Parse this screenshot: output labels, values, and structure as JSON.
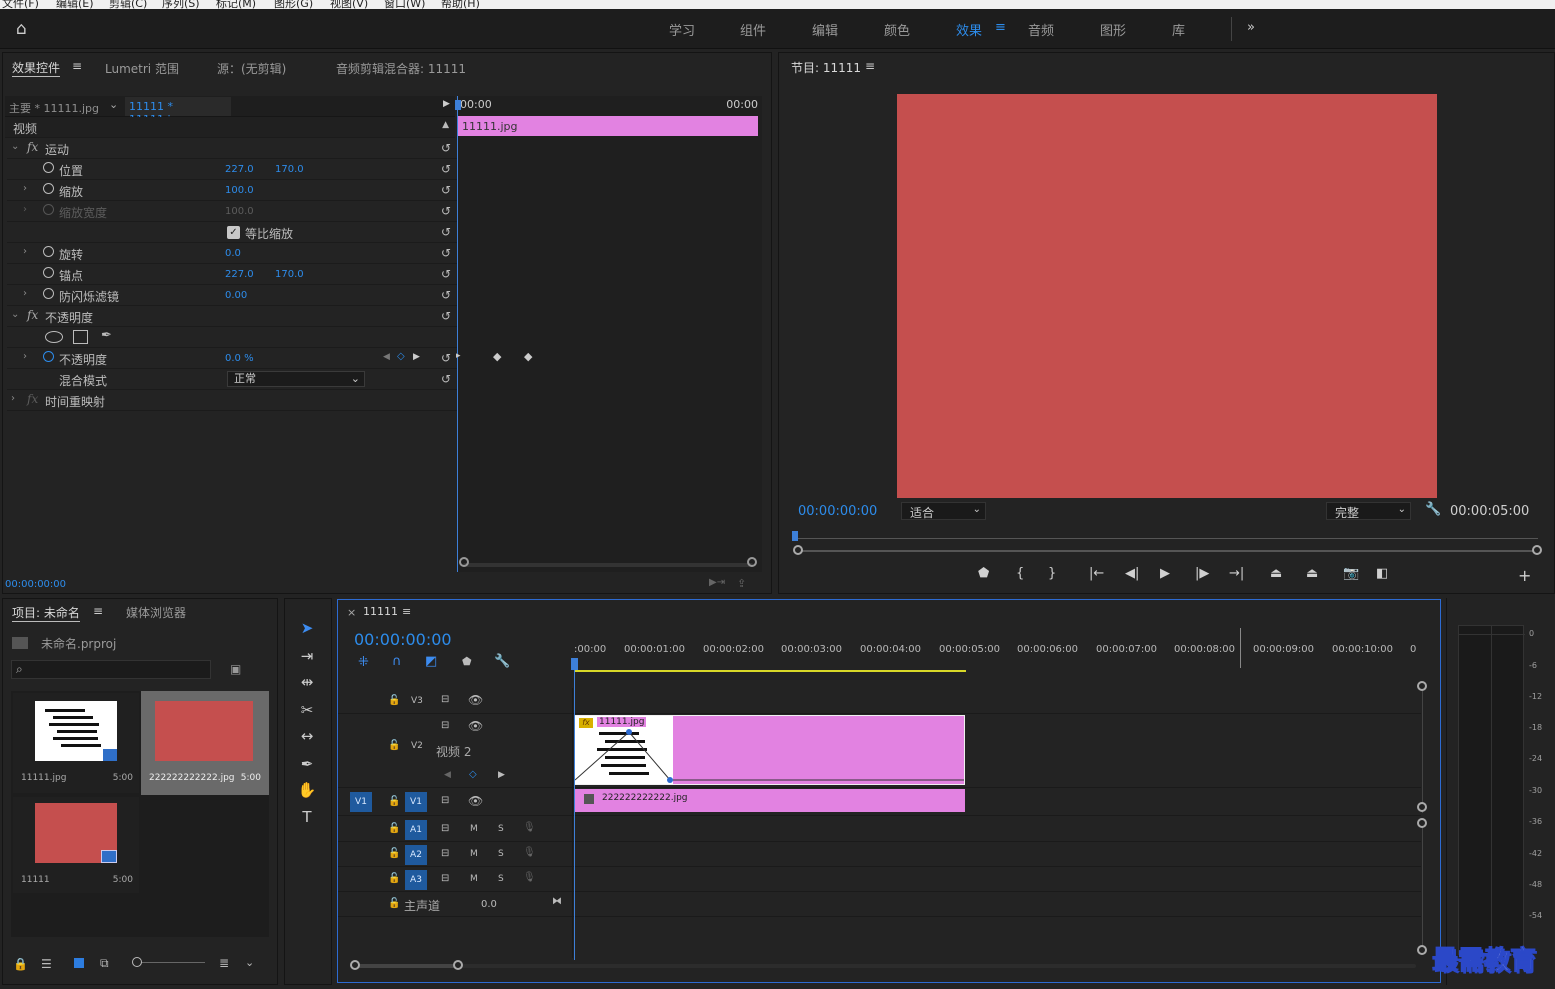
{
  "menubar": [
    "文件(F)",
    "编辑(E)",
    "剪辑(C)",
    "序列(S)",
    "标记(M)",
    "图形(G)",
    "视图(V)",
    "窗口(W)",
    "帮助(H)"
  ],
  "workspaces": [
    "学习",
    "组件",
    "编辑",
    "颜色",
    "效果",
    "音频",
    "图形",
    "库"
  ],
  "active_workspace": "效果",
  "more": "»",
  "effect_panel": {
    "tabs": [
      "效果控件",
      "Lumetri 范围",
      "源：(无剪辑)",
      "音频剪辑混合器: 11111"
    ],
    "menu": "≡",
    "master_clip": "主要 * 11111.jpg",
    "seq_clip": "11111 * 11111.jpg",
    "ruler_start": "00:00",
    "ruler_end": "00:00",
    "clip_bar": "11111.jpg",
    "section_video": "视频",
    "motion": "运动",
    "position": {
      "label": "位置",
      "x": "227.0",
      "y": "170.0"
    },
    "scale": {
      "label": "缩放",
      "value": "100.0"
    },
    "scale_width": {
      "label": "缩放宽度",
      "value": "100.0"
    },
    "uniform_scale": "等比缩放",
    "rotation": {
      "label": "旋转",
      "value": "0.0"
    },
    "anchor": {
      "label": "锚点",
      "x": "227.0",
      "y": "170.0"
    },
    "flicker": {
      "label": "防闪烁滤镜",
      "value": "0.00"
    },
    "opacity_group": "不透明度",
    "opacity": {
      "label": "不透明度",
      "value": "0.0 %"
    },
    "blend": {
      "label": "混合模式",
      "value": "正常"
    },
    "time_remap": "时间重映射",
    "timecode": "00:00:00:00"
  },
  "program": {
    "title": "节目: 11111",
    "timecode": "00:00:00:00",
    "fit": "适合",
    "quality": "完整",
    "duration": "00:00:05:00",
    "frame_color": "#c54f4e"
  },
  "project": {
    "tab": "项目: 未命名",
    "tab2": "媒体浏览器",
    "file": "未命名.prproj",
    "items": [
      {
        "name": "11111.jpg",
        "dur": "5:00"
      },
      {
        "name": "222222222222.jpg",
        "dur": "5:00"
      },
      {
        "name": "11111",
        "dur": "5:00"
      }
    ]
  },
  "timeline": {
    "tab": "11111",
    "timecode": "00:00:00:00",
    "ruler": [
      ":00:00",
      "00:00:01:00",
      "00:00:02:00",
      "00:00:03:00",
      "00:00:04:00",
      "00:00:05:00",
      "00:00:06:00",
      "00:00:07:00",
      "00:00:08:00",
      "00:00:09:00",
      "00:00:10:00",
      "0"
    ],
    "tracks": {
      "v3": "V3",
      "v2": "V2",
      "v2_name": "视频 2",
      "v1": "V1",
      "v1_src": "V1",
      "a1": "A1",
      "a2": "A2",
      "a3": "A3",
      "m": "M",
      "s": "S",
      "master": "主声道",
      "master_val": "0.0"
    },
    "clip_v2": "11111.jpg",
    "clip_v1": "222222222222.jpg",
    "clip_color": "#e282e1"
  },
  "meter": [
    "0",
    "-6",
    "-12",
    "-18",
    "-24",
    "-30",
    "-36",
    "-42",
    "-48",
    "-54"
  ],
  "watermark": "最需教育"
}
